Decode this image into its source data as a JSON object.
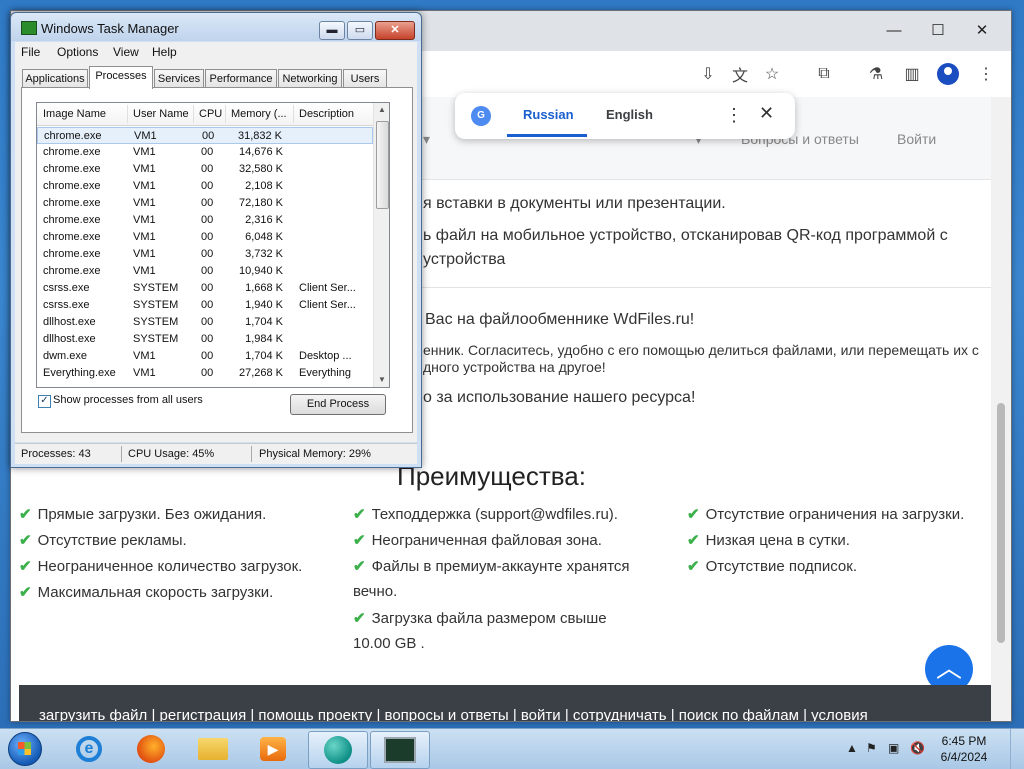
{
  "chrome": {
    "popup": {
      "logo": "G",
      "lang_source": "Russian",
      "lang_target": "English"
    },
    "nav": [
      "▾",
      "▾",
      "Вопросы и ответы",
      "Войти"
    ],
    "lines": [
      "я вставки в документы или презентации.",
      "ь файл на мобильное устройство, отсканировав QR-код программой с",
      "устройства",
      "Вас на файлообменнике WdFiles.ru!",
      "енник. Согласитесь, удобно с его помощью делиться файлами, или перемещать их с",
      "дного устройства на другое!",
      "о за использование нашего ресурса!"
    ],
    "heading": "Преимущества:",
    "advantages_col1": [
      "Прямые загрузки. Без ожидания.",
      "Отсутствие рекламы.",
      "Неограниченное количество загрузок.",
      "Максимальная скорость загрузки."
    ],
    "advantages_col2": [
      "Техподдержка (support@wdfiles.ru).",
      "Неограниченная файловая зона.",
      "Файлы в премиум-аккаунте хранятся",
      "вечно.",
      "Загрузка файла размером свыше",
      "10.00 GB ."
    ],
    "advantages_col3": [
      "Отсутствие ограничения на загрузки.",
      "Низкая цена в сутки.",
      "Отсутствие подписок."
    ],
    "footer": "загрузить файл  |  регистрация  |  помощь проекту  |  вопросы и ответы  |  войти  |  сотрудничать  |  поиск по файлам  |  условия"
  },
  "taskmanager": {
    "title": "Windows Task Manager",
    "menu": [
      "File",
      "Options",
      "View",
      "Help"
    ],
    "tabs": [
      "Applications",
      "Processes",
      "Services",
      "Performance",
      "Networking",
      "Users"
    ],
    "columns": [
      "Image Name",
      "User Name",
      "CPU",
      "Memory (...",
      "Description"
    ],
    "rows": [
      [
        "chrome.exe",
        "VM1",
        "00",
        "31,832 K",
        ""
      ],
      [
        "chrome.exe",
        "VM1",
        "00",
        "14,676 K",
        ""
      ],
      [
        "chrome.exe",
        "VM1",
        "00",
        "32,580 K",
        ""
      ],
      [
        "chrome.exe",
        "VM1",
        "00",
        "2,108 K",
        ""
      ],
      [
        "chrome.exe",
        "VM1",
        "00",
        "72,180 K",
        ""
      ],
      [
        "chrome.exe",
        "VM1",
        "00",
        "2,316 K",
        ""
      ],
      [
        "chrome.exe",
        "VM1",
        "00",
        "6,048 K",
        ""
      ],
      [
        "chrome.exe",
        "VM1",
        "00",
        "3,732 K",
        ""
      ],
      [
        "chrome.exe",
        "VM1",
        "00",
        "10,940 K",
        ""
      ],
      [
        "csrss.exe",
        "SYSTEM",
        "00",
        "1,668 K",
        "Client Ser..."
      ],
      [
        "csrss.exe",
        "SYSTEM",
        "00",
        "1,940 K",
        "Client Ser..."
      ],
      [
        "dllhost.exe",
        "SYSTEM",
        "00",
        "1,704 K",
        ""
      ],
      [
        "dllhost.exe",
        "SYSTEM",
        "00",
        "1,984 K",
        ""
      ],
      [
        "dwm.exe",
        "VM1",
        "00",
        "1,704 K",
        "Desktop ..."
      ],
      [
        "Everything.exe",
        "VM1",
        "00",
        "27,268 K",
        "Everything"
      ]
    ],
    "show_all_label": "Show processes from all users",
    "end_process_label": "End Process",
    "status": {
      "processes": "Processes: 43",
      "cpu": "CPU Usage: 45%",
      "memory": "Physical Memory: 29%"
    }
  },
  "taskbar": {
    "clock_time": "6:45 PM",
    "clock_date": "6/4/2024"
  }
}
